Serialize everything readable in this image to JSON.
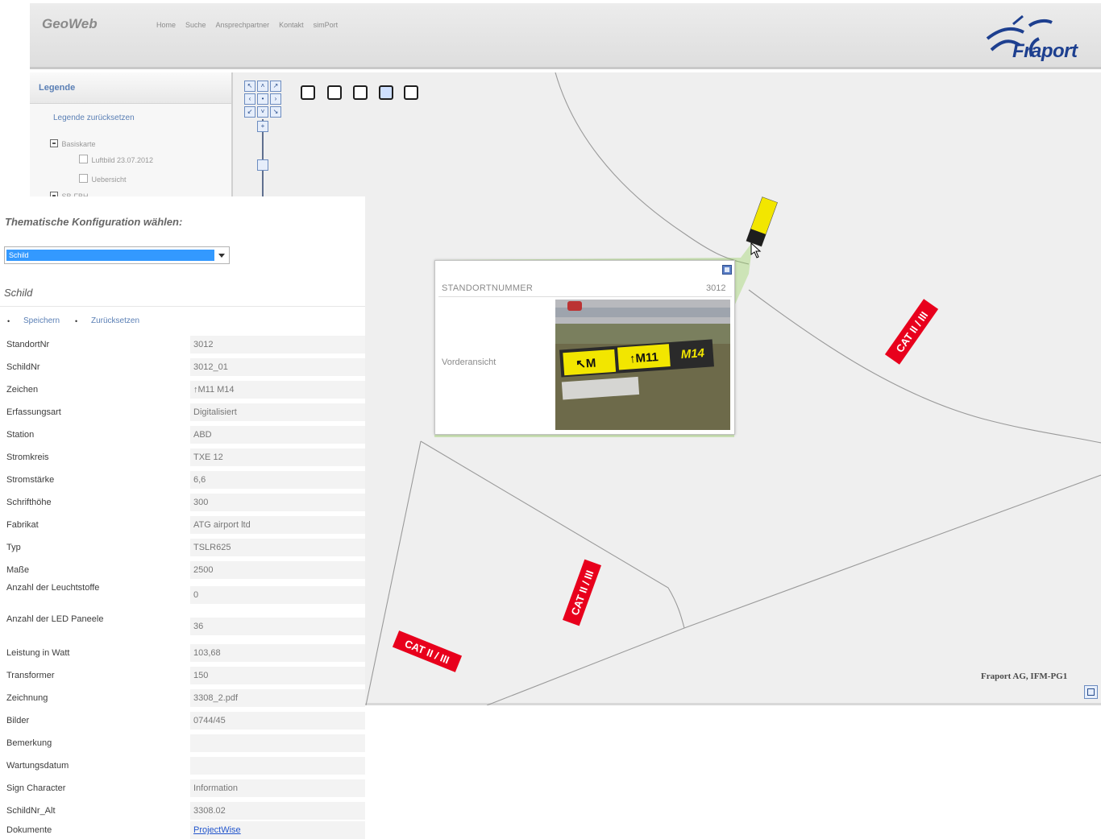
{
  "app": {
    "title": "GeoWeb",
    "nav": [
      "Home",
      "Suche",
      "Ansprechpartner",
      "Kontakt",
      "simPort"
    ],
    "logo_text": "Fraport"
  },
  "legend": {
    "title": "Legende",
    "reset_link": "Legende zurücksetzen",
    "tree": [
      {
        "label": "Basiskarte",
        "expanded": true
      },
      {
        "label": "Luftbild 23.07.2012",
        "checked": false
      },
      {
        "label": "Uebersicht",
        "checked": false
      },
      {
        "label": "SB-FBH",
        "expanded": true
      }
    ]
  },
  "toolbar": {
    "icons": [
      "pan-icon",
      "full-extent-icon",
      "zoom-window-icon",
      "map-image-icon",
      "print-icon"
    ]
  },
  "theme": {
    "label": "Thematische Konfiguration wählen:",
    "selected": "Schild"
  },
  "section": {
    "title": "Schild",
    "save": "Speichern",
    "reset": "Zurücksetzen"
  },
  "attributes": [
    {
      "key": "StandortNr",
      "value": "3012"
    },
    {
      "key": "SchildNr",
      "value": "3012_01"
    },
    {
      "key": "Zeichen",
      "value": "↑M11 M14"
    },
    {
      "key": "Erfassungsart",
      "value": "Digitalisiert"
    },
    {
      "key": "Station",
      "value": "ABD"
    },
    {
      "key": "Stromkreis",
      "value": "TXE 12"
    },
    {
      "key": "Stromstärke",
      "value": "6,6"
    },
    {
      "key": "Schrifthöhe",
      "value": "300"
    },
    {
      "key": "Fabrikat",
      "value": "ATG airport ltd"
    },
    {
      "key": "Typ",
      "value": "TSLR625"
    },
    {
      "key": "Maße",
      "value": "2500"
    },
    {
      "key": "Anzahl der Leuchtstoffe",
      "value": "0"
    },
    {
      "key": "Anzahl der LED Paneele",
      "value": "36"
    },
    {
      "key": "Leistung in Watt",
      "value": "103,68"
    },
    {
      "key": "Transformer",
      "value": "150"
    },
    {
      "key": "Zeichnung",
      "value": "3308_2.pdf"
    },
    {
      "key": "Bilder",
      "value": "0744/45"
    },
    {
      "key": "Bemerkung",
      "value": ""
    },
    {
      "key": "Wartungsdatum",
      "value": ""
    },
    {
      "key": "Sign Character",
      "value": "Information"
    },
    {
      "key": "SchildNr_Alt",
      "value": "3308.02"
    },
    {
      "key": "Dokumente",
      "value": "ProjectWise",
      "link": true
    }
  ],
  "popup": {
    "header_label": "STANDORTNUMMER",
    "header_value": "3012",
    "photo_label": "Vorderansicht",
    "sign_text_1": "↖M",
    "sign_text_2": "↑M11",
    "sign_text_3": "M14"
  },
  "map": {
    "labels": [
      "CAT II / III",
      "CAT II / III",
      "CAT II / III"
    ],
    "attribution": "Fraport AG, IFM-PG1"
  },
  "colors": {
    "accent": "#3399ff",
    "link": "#5a7fb5",
    "cat_label": "#e8001c",
    "sign_yellow": "#f2e600"
  }
}
